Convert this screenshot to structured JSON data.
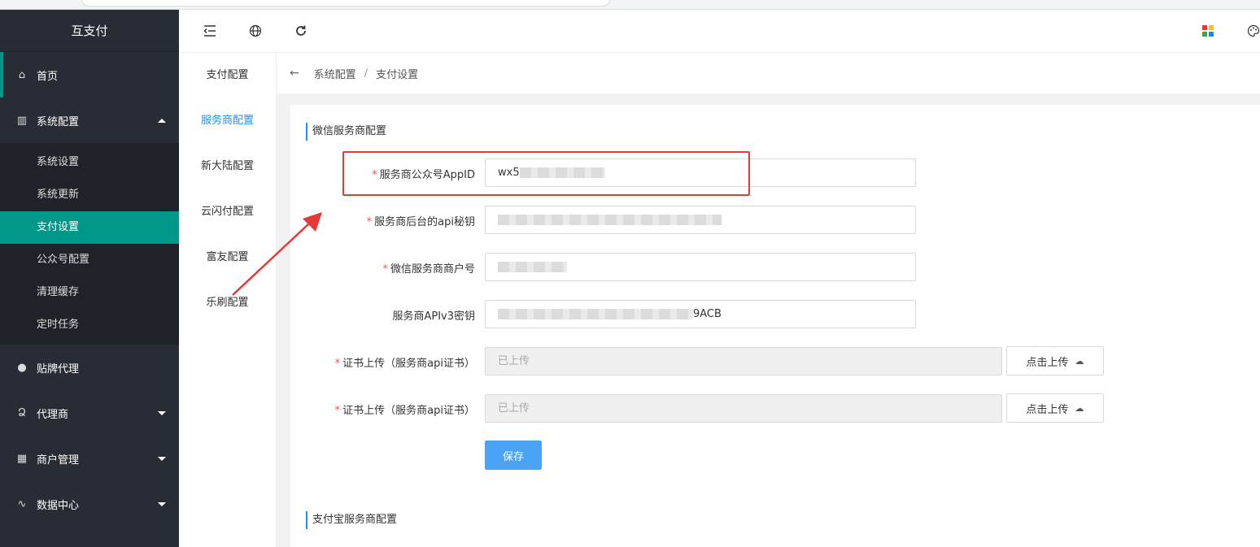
{
  "brand": "互支付",
  "sidebar": {
    "items": [
      {
        "label": "首页",
        "icon": "home-icon"
      },
      {
        "label": "系统配置",
        "icon": "settings-grid-icon"
      },
      {
        "label": "贴牌代理",
        "icon": "user-icon"
      },
      {
        "label": "代理商",
        "icon": "person-outline-icon"
      },
      {
        "label": "商户管理",
        "icon": "store-icon"
      },
      {
        "label": "数据中心",
        "icon": "pulse-icon"
      }
    ],
    "submenu": [
      "系统设置",
      "系统更新",
      "支付设置",
      "公众号配置",
      "清理缓存",
      "定时任务"
    ]
  },
  "subnav": [
    "支付配置",
    "服务商配置",
    "新大陆配置",
    "云闪付配置",
    "富友配置",
    "乐刷配置"
  ],
  "breadcrumb": {
    "parent": "系统配置",
    "separator": "/",
    "current": "支付设置"
  },
  "sections": {
    "wechat": "微信服务商配置",
    "alipay": "支付宝服务商配置"
  },
  "form": {
    "appid_label": "服务商公众号AppID",
    "appid_value": "wx5",
    "api_secret_label": "服务商后台的api秘钥",
    "merchant_no_label": "微信服务商商户号",
    "apiv3_label": "服务商APIv3密钥",
    "apiv3_value_tail": "9ACB",
    "cert1_label": "证书上传（服务商api证书）",
    "cert1_value": "已上传",
    "cert2_label": "证书上传（服务商api证书）",
    "cert2_value": "已上传",
    "upload_label": "点击上传",
    "save_label": "保存"
  },
  "colors": {
    "sidebar_bg": "#282c34",
    "accent": "#009688",
    "primary": "#1890ff",
    "highlight": "#e53935",
    "required": "#ff4d4f"
  }
}
